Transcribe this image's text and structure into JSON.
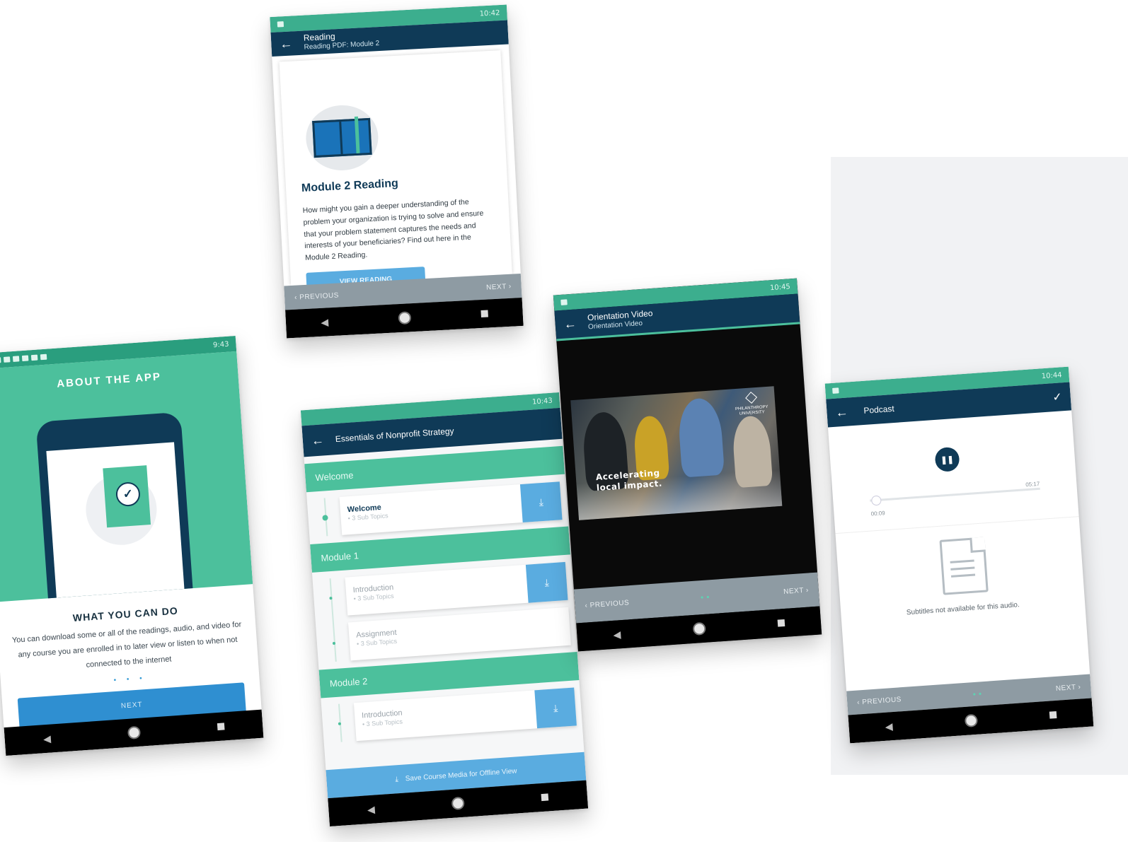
{
  "about": {
    "status_time": "9:43",
    "title": "ABOUT THE APP",
    "heading": "WHAT YOU CAN DO",
    "body": "You can download some or all of the readings, audio, and video for any course you are enrolled in to later view or listen to when not connected to the internet",
    "next_label": "NEXT"
  },
  "reading": {
    "status_time": "10:42",
    "title": "Reading",
    "subtitle": "Reading PDF: Module 2",
    "heading": "Module 2 Reading",
    "body": "How might you gain a deeper understanding of the problem your organization is trying to solve and ensure that your problem statement captures the needs and interests of your beneficiaries? Find out here in the Module 2 Reading.",
    "view_label": "VIEW READING",
    "prev_label": "PREVIOUS",
    "next_label": "NEXT"
  },
  "course": {
    "status_time": "10:43",
    "title": "Essentials of Nonprofit Strategy",
    "sections": [
      {
        "name": "Welcome",
        "topics": [
          {
            "name": "Welcome",
            "sub": "• 3 Sub Topics"
          }
        ]
      },
      {
        "name": "Module 1",
        "topics": [
          {
            "name": "Introduction",
            "sub": "• 3 Sub Topics"
          },
          {
            "name": "Assignment",
            "sub": "• 3 Sub Topics"
          }
        ]
      },
      {
        "name": "Module 2",
        "topics": [
          {
            "name": "Introduction",
            "sub": "• 3 Sub Topics"
          }
        ]
      }
    ],
    "save_label": "Save Course Media for Offline View"
  },
  "video": {
    "status_time": "10:45",
    "title": "Orientation Video",
    "subtitle": "Orientation Video",
    "caption_line1": "Accelerating",
    "caption_line2": "local impact.",
    "logo_line1": "PHILANTHROPY",
    "logo_line2": "UNIVERSITY",
    "prev_label": "PREVIOUS",
    "next_label": "NEXT"
  },
  "podcast": {
    "status_time": "10:44",
    "title": "Podcast",
    "time_start": "00:09",
    "time_end": "05:17",
    "subtitles_msg": "Subtitles not available for this audio.",
    "prev_label": "PREVIOUS",
    "next_label": "NEXT",
    "progress": 0.03
  },
  "icons": {
    "back": "←",
    "check": "✓",
    "chev_left": "‹",
    "chev_right": "›",
    "download": "⤓",
    "nav_back": "◀"
  },
  "colors": {
    "teal": "#4cc09c",
    "navy": "#0f3a57",
    "blue": "#5aace0",
    "button_blue": "#2f8fd1"
  }
}
